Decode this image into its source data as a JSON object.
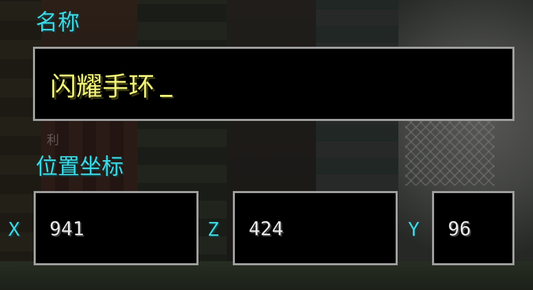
{
  "name_section": {
    "label": "名称",
    "input_value": "闪耀手环"
  },
  "background_hint": "利",
  "position_section": {
    "label": "位置坐标",
    "x": {
      "axis": "X",
      "value": "941"
    },
    "z": {
      "axis": "Z",
      "value": "424"
    },
    "y": {
      "axis": "Y",
      "value": "96"
    }
  },
  "colors": {
    "label": "#3fd8e4",
    "name_text": "#f2f27a",
    "coord_text": "#eaeaea",
    "field_border": "#a0a0a0",
    "field_bg": "#000000"
  }
}
